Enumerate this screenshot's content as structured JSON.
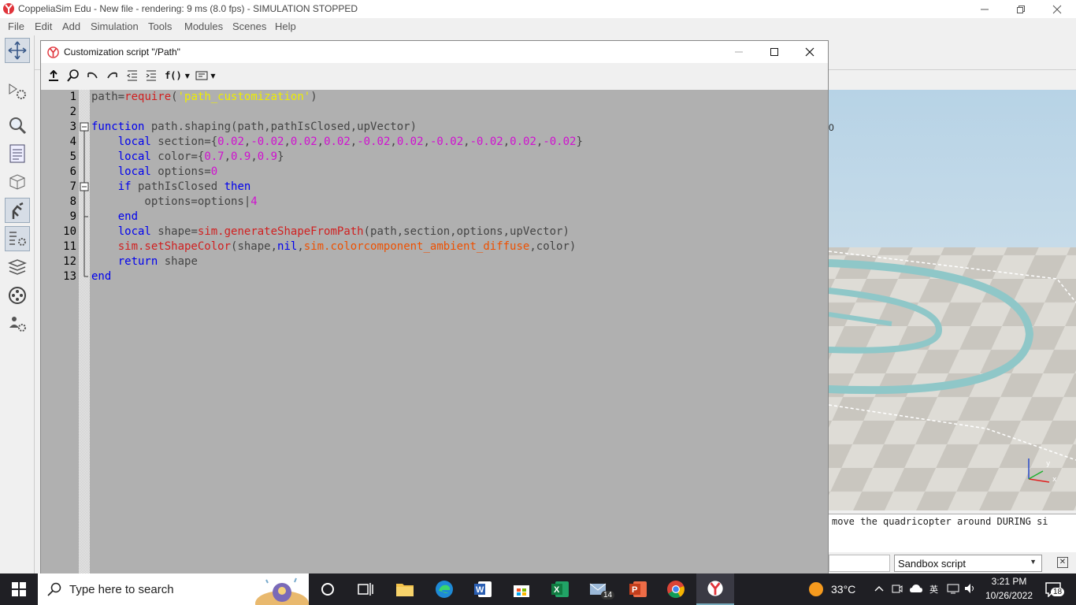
{
  "app": {
    "title": "CoppeliaSim Edu - New file - rendering: 9 ms (8.0 fps) - SIMULATION STOPPED",
    "menu": [
      "File",
      "Edit",
      "Add",
      "Simulation",
      "Tools",
      "Modules",
      "Scenes",
      "Help"
    ]
  },
  "script_window": {
    "title": "Customization script \"/Path\"",
    "toolbar_func_label": "f()"
  },
  "code_lines": [
    {
      "num": "1",
      "tokens": [
        {
          "t": "path=",
          "c": "p"
        },
        {
          "t": "require",
          "c": "fn"
        },
        {
          "t": "(",
          "c": "p"
        },
        {
          "t": "'path_customization'",
          "c": "str"
        },
        {
          "t": ")",
          "c": "p"
        }
      ]
    },
    {
      "num": "2",
      "tokens": []
    },
    {
      "num": "3",
      "tokens": [
        {
          "t": "function",
          "c": "kw"
        },
        {
          "t": " path.shaping(path,pathIsClosed,upVector)",
          "c": "p"
        }
      ]
    },
    {
      "num": "4",
      "tokens": [
        {
          "t": "    ",
          "c": "p"
        },
        {
          "t": "local",
          "c": "kw"
        },
        {
          "t": " section={",
          "c": "p"
        },
        {
          "t": "0.02",
          "c": "num"
        },
        {
          "t": ",",
          "c": "p"
        },
        {
          "t": "-0.02",
          "c": "num"
        },
        {
          "t": ",",
          "c": "p"
        },
        {
          "t": "0.02",
          "c": "num"
        },
        {
          "t": ",",
          "c": "p"
        },
        {
          "t": "0.02",
          "c": "num"
        },
        {
          "t": ",",
          "c": "p"
        },
        {
          "t": "-0.02",
          "c": "num"
        },
        {
          "t": ",",
          "c": "p"
        },
        {
          "t": "0.02",
          "c": "num"
        },
        {
          "t": ",",
          "c": "p"
        },
        {
          "t": "-0.02",
          "c": "num"
        },
        {
          "t": ",",
          "c": "p"
        },
        {
          "t": "-0.02",
          "c": "num"
        },
        {
          "t": ",",
          "c": "p"
        },
        {
          "t": "0.02",
          "c": "num"
        },
        {
          "t": ",",
          "c": "p"
        },
        {
          "t": "-0.02",
          "c": "num"
        },
        {
          "t": "}",
          "c": "p"
        }
      ]
    },
    {
      "num": "5",
      "tokens": [
        {
          "t": "    ",
          "c": "p"
        },
        {
          "t": "local",
          "c": "kw"
        },
        {
          "t": " color={",
          "c": "p"
        },
        {
          "t": "0.7",
          "c": "num"
        },
        {
          "t": ",",
          "c": "p"
        },
        {
          "t": "0.9",
          "c": "num"
        },
        {
          "t": ",",
          "c": "p"
        },
        {
          "t": "0.9",
          "c": "num"
        },
        {
          "t": "}",
          "c": "p"
        }
      ]
    },
    {
      "num": "6",
      "tokens": [
        {
          "t": "    ",
          "c": "p"
        },
        {
          "t": "local",
          "c": "kw"
        },
        {
          "t": " options=",
          "c": "p"
        },
        {
          "t": "0",
          "c": "num"
        }
      ]
    },
    {
      "num": "7",
      "tokens": [
        {
          "t": "    ",
          "c": "p"
        },
        {
          "t": "if",
          "c": "kw"
        },
        {
          "t": " pathIsClosed ",
          "c": "p"
        },
        {
          "t": "then",
          "c": "kw"
        }
      ]
    },
    {
      "num": "8",
      "tokens": [
        {
          "t": "        options=options|",
          "c": "p"
        },
        {
          "t": "4",
          "c": "num"
        }
      ]
    },
    {
      "num": "9",
      "tokens": [
        {
          "t": "    ",
          "c": "p"
        },
        {
          "t": "end",
          "c": "kw"
        }
      ]
    },
    {
      "num": "10",
      "tokens": [
        {
          "t": "    ",
          "c": "p"
        },
        {
          "t": "local",
          "c": "kw"
        },
        {
          "t": " shape=",
          "c": "p"
        },
        {
          "t": "sim.generateShapeFromPath",
          "c": "fn"
        },
        {
          "t": "(path,section,options,upVector)",
          "c": "p"
        }
      ]
    },
    {
      "num": "11",
      "tokens": [
        {
          "t": "    ",
          "c": "p"
        },
        {
          "t": "sim.setShapeColor",
          "c": "fn"
        },
        {
          "t": "(shape,",
          "c": "p"
        },
        {
          "t": "nil",
          "c": "kw"
        },
        {
          "t": ",",
          "c": "p"
        },
        {
          "t": "sim.colorcomponent_ambient_diffuse",
          "c": "const"
        },
        {
          "t": ",color)",
          "c": "p"
        }
      ]
    },
    {
      "num": "12",
      "tokens": [
        {
          "t": "    ",
          "c": "p"
        },
        {
          "t": "return",
          "c": "kw"
        },
        {
          "t": " shape",
          "c": "p"
        }
      ]
    },
    {
      "num": "13",
      "tokens": [
        {
          "t": "end",
          "c": "kw"
        }
      ]
    }
  ],
  "viewport": {
    "partial_label": "0",
    "axis_x": "x",
    "axis_y": "y"
  },
  "console": {
    "text": "move the quadricopter around DURING si"
  },
  "sandbox": {
    "selected": "Sandbox script"
  },
  "taskbar": {
    "search_placeholder": "Type here to search",
    "mail_badge": "14",
    "weather": "33°C",
    "time": "3:21 PM",
    "date": "10/26/2022",
    "notification_count": "18"
  },
  "colors": {
    "editor_bg": "#b0b0b0",
    "keyword": "#0000ee",
    "function": "#d02020",
    "number": "#d010d0",
    "string": "#eded00",
    "constant": "#ee5000",
    "taskbar_bg": "#1f1f24"
  }
}
